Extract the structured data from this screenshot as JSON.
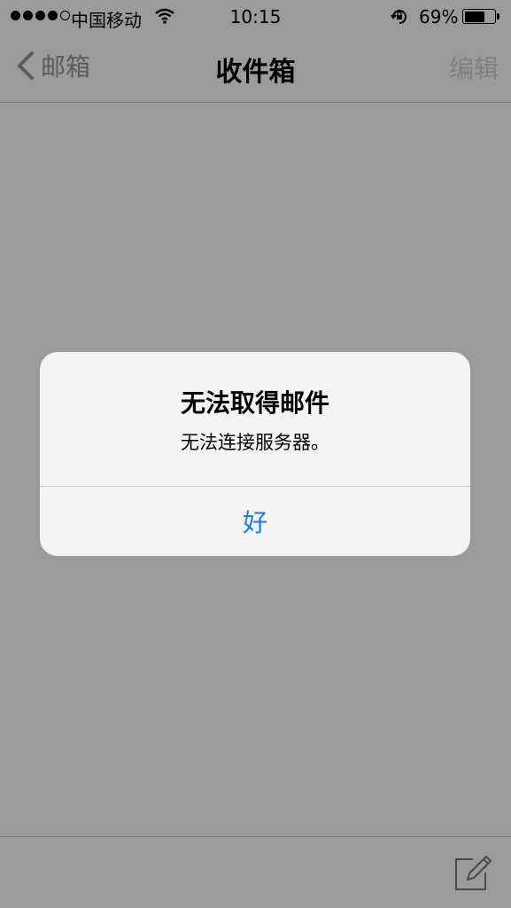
{
  "status_bar": {
    "carrier": "中国移动",
    "time": "10:15",
    "battery_percent": "69%",
    "battery_level": 0.69,
    "signal_bars": 4,
    "signal_total": 5
  },
  "nav": {
    "back_label": "邮箱",
    "title": "收件箱",
    "edit_label": "编辑"
  },
  "alert": {
    "title": "无法取得邮件",
    "message": "无法连接服务器。",
    "button_label": "好"
  },
  "colors": {
    "dimmed_background": "#9b9b9b",
    "alert_button": "#1a7ae8"
  },
  "icons": {
    "back": "chevron-left-icon",
    "compose": "compose-icon",
    "wifi": "wifi-icon",
    "rotation_lock": "rotation-lock-icon"
  }
}
